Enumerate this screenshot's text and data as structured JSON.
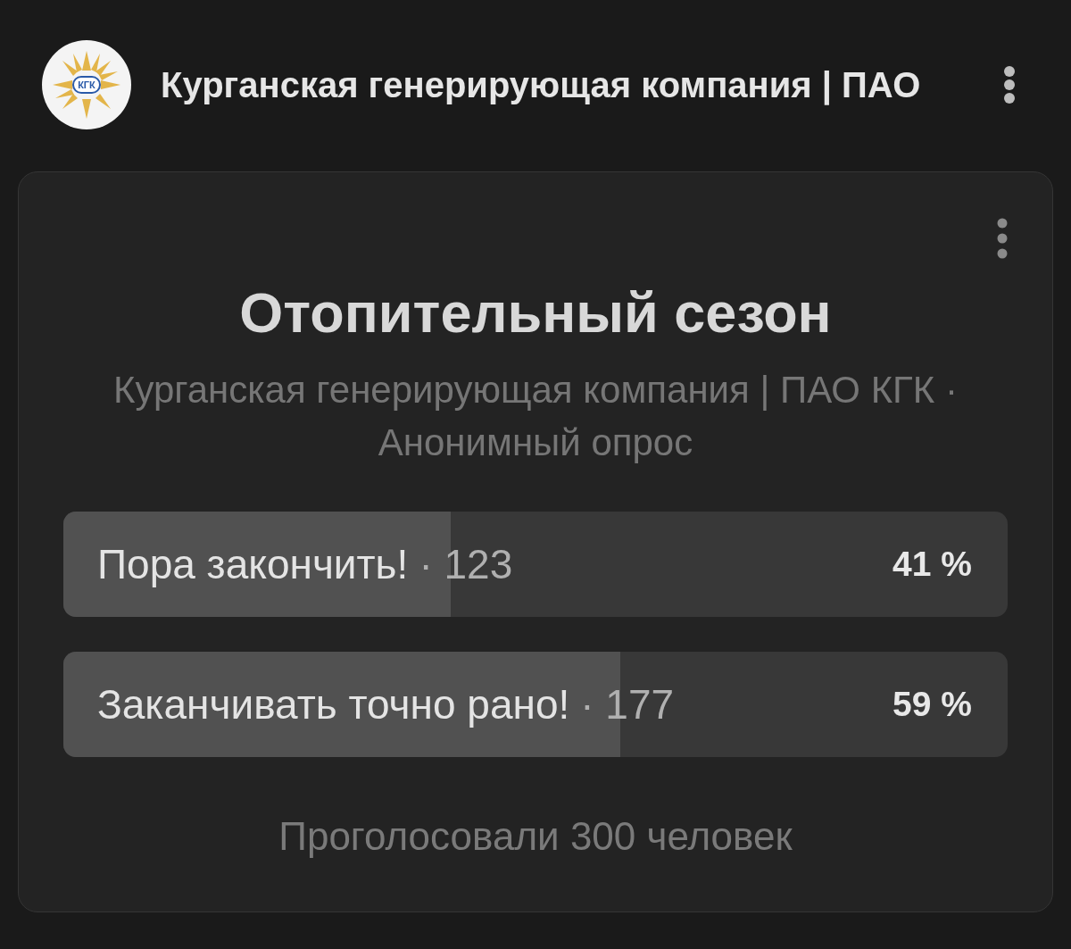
{
  "header": {
    "logo_text": "КГК",
    "title": "Курганская генерирующая компания | ПАО"
  },
  "poll": {
    "title": "Отопительный сезон",
    "subtitle": "Курганская генерирующая компания | ПАО КГК · Анонимный опрос",
    "options": [
      {
        "label": "Пора закончить!",
        "count": "· 123",
        "percent": "41 %",
        "level": 0.41
      },
      {
        "label": "Заканчивать точно рано!",
        "count": "· 177",
        "percent": "59 %",
        "level": 0.59
      }
    ],
    "total": "Проголосовали 300 человек"
  }
}
